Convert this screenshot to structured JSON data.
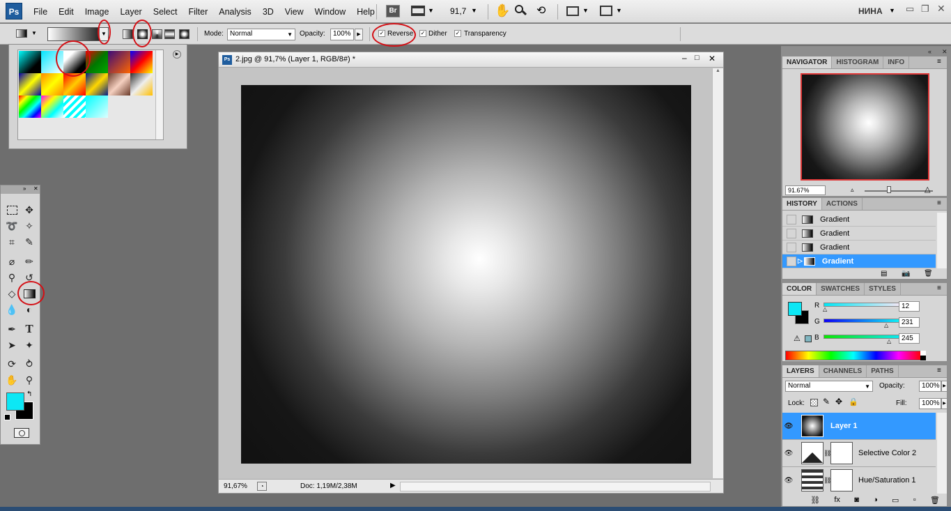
{
  "app": {
    "logo": "Ps",
    "brand_color": "#1f5d9e"
  },
  "menu": [
    "File",
    "Edit",
    "Image",
    "Layer",
    "Select",
    "Filter",
    "Analysis",
    "3D",
    "View",
    "Window",
    "Help"
  ],
  "appbar": {
    "bridge_label": "Br",
    "zoom": "91,7",
    "workspace": "НИНА"
  },
  "options": {
    "mode_label": "Mode:",
    "mode_value": "Normal",
    "opacity_label": "Opacity:",
    "opacity_value": "100%",
    "reverse_label": "Reverse",
    "reverse_checked": true,
    "dither_label": "Dither",
    "dither_checked": true,
    "transparency_label": "Transparency",
    "transparency_checked": true
  },
  "document": {
    "title": "2.jpg @ 91,7% (Layer 1, RGB/8#) *",
    "zoom_status": "91,67%",
    "doc_info": "Doc: 1,19M/2,38M"
  },
  "navigator": {
    "tabs": [
      "NAVIGATOR",
      "HISTOGRAM",
      "INFO"
    ],
    "zoom": "91.67%"
  },
  "history": {
    "tabs": [
      "HISTORY",
      "ACTIONS"
    ],
    "items": [
      {
        "label": "Gradient",
        "selected": false
      },
      {
        "label": "Gradient",
        "selected": false
      },
      {
        "label": "Gradient",
        "selected": false
      },
      {
        "label": "Gradient",
        "selected": true
      }
    ]
  },
  "color": {
    "tabs": [
      "COLOR",
      "SWATCHES",
      "STYLES"
    ],
    "r_label": "R",
    "r_value": "12",
    "g_label": "G",
    "g_value": "231",
    "b_label": "B",
    "b_value": "245",
    "foreground": "#0ce7f5",
    "background": "#000000"
  },
  "layers": {
    "tabs": [
      "LAYERS",
      "CHANNELS",
      "PATHS"
    ],
    "blend_mode": "Normal",
    "opacity_label": "Opacity:",
    "opacity_value": "100%",
    "lock_label": "Lock:",
    "fill_label": "Fill:",
    "fill_value": "100%",
    "items": [
      {
        "name": "Layer 1",
        "selected": true
      },
      {
        "name": "Selective Color 2",
        "selected": false
      },
      {
        "name": "Hue/Saturation 1",
        "selected": false
      }
    ]
  },
  "colors": {
    "selection_blue": "#3399ff",
    "annotation_red": "#d40f15"
  }
}
